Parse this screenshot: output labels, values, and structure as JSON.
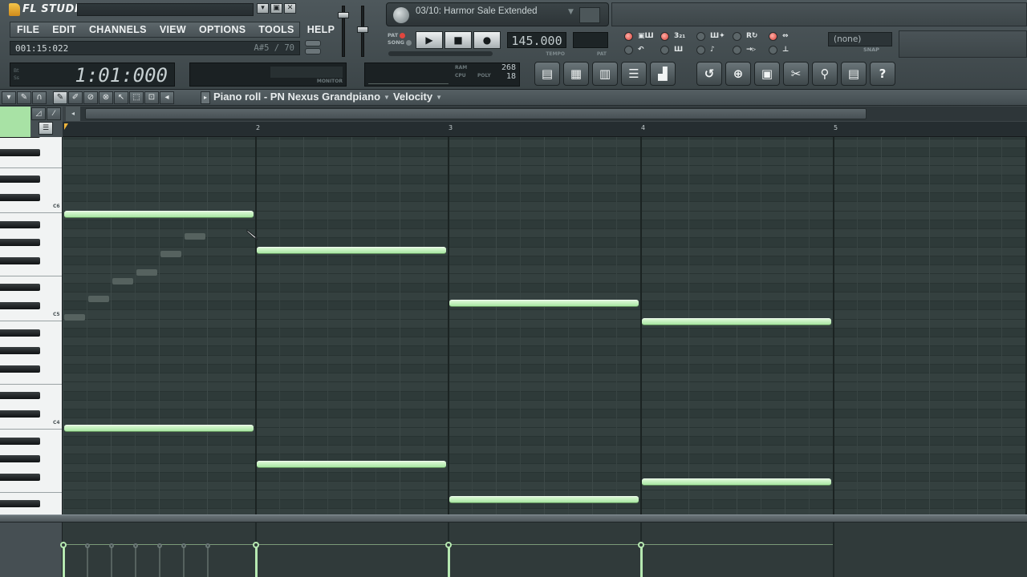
{
  "app": {
    "logo_text": "FL STUDIO",
    "window_buttons": [
      "▾",
      "▣",
      "✕"
    ]
  },
  "menu": [
    "FILE",
    "EDIT",
    "CHANNELS",
    "VIEW",
    "OPTIONS",
    "TOOLS",
    "HELP"
  ],
  "hint": {
    "time": "001:15:022",
    "note": "A#5 / 70"
  },
  "song": {
    "title": "03/10: Harmor Sale Extended"
  },
  "transport": {
    "pat_label": "PAT",
    "song_label": "SONG",
    "play": "▶",
    "stop": "■",
    "record": "●",
    "tempo_value": "145.000",
    "tempo_label": "TEMPO",
    "pat_label2": "PAT"
  },
  "snap": {
    "value": "(none)",
    "label": "SNAP"
  },
  "time_display": {
    "value": "1:01:000",
    "label_top": "Bt",
    "label_bottom": "Ss"
  },
  "monitor": {
    "label": "MONITOR"
  },
  "cpu": {
    "value1": "268",
    "value2": "18",
    "ram_label": "RAM",
    "cpu_label": "CPU",
    "poly_label": "POLY"
  },
  "window_buttons": [
    {
      "name": "playlist-icon",
      "glyph": "▤"
    },
    {
      "name": "step-sequencer-icon",
      "glyph": "▦"
    },
    {
      "name": "piano-roll-icon",
      "glyph": "▥"
    },
    {
      "name": "browser-icon",
      "glyph": "☰"
    },
    {
      "name": "mixer-icon",
      "glyph": "▟"
    }
  ],
  "util_buttons": [
    {
      "name": "undo-icon",
      "glyph": "↺"
    },
    {
      "name": "save-as-icon",
      "glyph": "⊕"
    },
    {
      "name": "save-icon",
      "glyph": "▣"
    },
    {
      "name": "tools-icon",
      "glyph": "✂"
    },
    {
      "name": "record-audio-icon",
      "glyph": "⚲"
    },
    {
      "name": "notes-icon",
      "glyph": "▤"
    },
    {
      "name": "help-icon",
      "glyph": "?"
    }
  ],
  "piano_roll": {
    "title": "Piano roll - PN Nexus Grandpiano",
    "target": "Velocity",
    "ruler": [
      "2",
      "3",
      "4",
      "5"
    ],
    "octave_labels": [
      "C6",
      "C5",
      "C4"
    ],
    "notes": [
      {
        "bar": 0,
        "row": 0
      },
      {
        "bar": 1,
        "row": 2
      },
      {
        "bar": 2,
        "row": 5
      },
      {
        "bar": 3,
        "row": 6
      },
      {
        "bar": 0,
        "row": 12
      },
      {
        "bar": 1,
        "row": 14
      },
      {
        "bar": 2,
        "row": 16
      },
      {
        "bar": 3,
        "row": 15
      }
    ]
  }
}
